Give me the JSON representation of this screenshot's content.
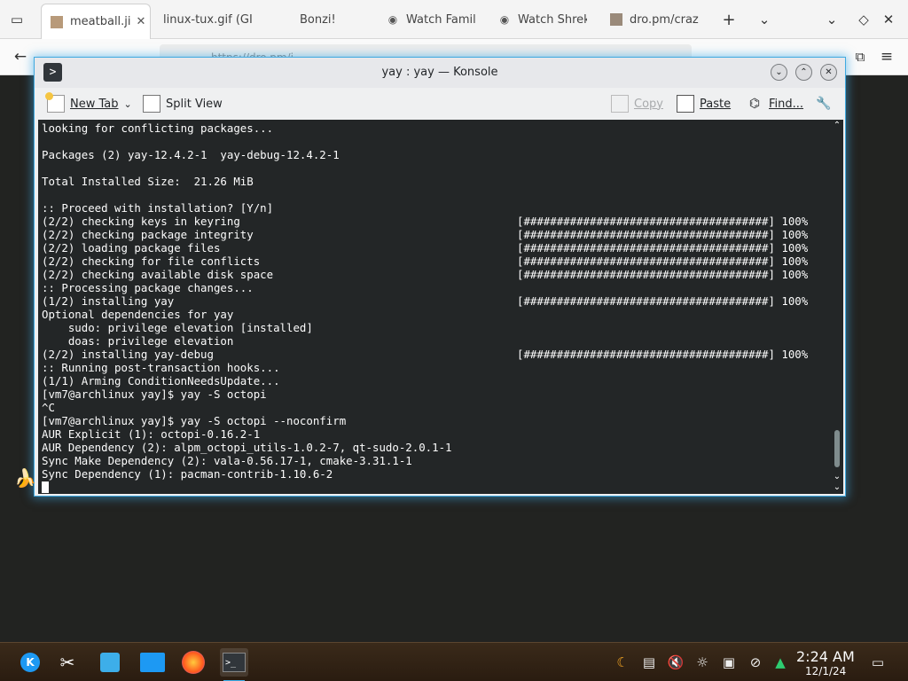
{
  "browser": {
    "tabs": [
      {
        "label": "meatball.ji",
        "icon": "image-icon",
        "active": true
      },
      {
        "label": "linux-tux.gif (GI",
        "icon": "none"
      },
      {
        "label": "Bonzi!",
        "icon": "none"
      },
      {
        "label": "Watch Famil",
        "icon": "wifi-icon"
      },
      {
        "label": "Watch Shrek",
        "icon": "wifi-icon"
      },
      {
        "label": "dro.pm/craz",
        "icon": "image-icon"
      }
    ],
    "url": "https://dro.pm/i"
  },
  "konsole": {
    "title": "yay : yay — Konsole",
    "toolbar": {
      "new_tab": "New Tab",
      "split_view": "Split View",
      "copy": "Copy",
      "paste": "Paste",
      "find": "Find..."
    },
    "terminal_lines": [
      {
        "text": "looking for conflicting packages...",
        "bar": ""
      },
      {
        "text": "",
        "bar": ""
      },
      {
        "text": "Packages (2) yay-12.4.2-1  yay-debug-12.4.2-1",
        "bar": ""
      },
      {
        "text": "",
        "bar": ""
      },
      {
        "text": "Total Installed Size:  21.26 MiB",
        "bar": ""
      },
      {
        "text": "",
        "bar": ""
      },
      {
        "text": ":: Proceed with installation? [Y/n]",
        "bar": ""
      },
      {
        "text": "(2/2) checking keys in keyring",
        "bar": "[#####################################] 100%"
      },
      {
        "text": "(2/2) checking package integrity",
        "bar": "[#####################################] 100%"
      },
      {
        "text": "(2/2) loading package files",
        "bar": "[#####################################] 100%"
      },
      {
        "text": "(2/2) checking for file conflicts",
        "bar": "[#####################################] 100%"
      },
      {
        "text": "(2/2) checking available disk space",
        "bar": "[#####################################] 100%"
      },
      {
        "text": ":: Processing package changes...",
        "bar": ""
      },
      {
        "text": "(1/2) installing yay",
        "bar": "[#####################################] 100%"
      },
      {
        "text": "Optional dependencies for yay",
        "bar": ""
      },
      {
        "text": "    sudo: privilege elevation [installed]",
        "bar": ""
      },
      {
        "text": "    doas: privilege elevation",
        "bar": ""
      },
      {
        "text": "(2/2) installing yay-debug",
        "bar": "[#####################################] 100%"
      },
      {
        "text": ":: Running post-transaction hooks...",
        "bar": ""
      },
      {
        "text": "(1/1) Arming ConditionNeedsUpdate...",
        "bar": ""
      },
      {
        "text": "[vm7@archlinux yay]$ yay -S octopi",
        "bar": ""
      },
      {
        "text": "^C",
        "bar": ""
      },
      {
        "text": "[vm7@archlinux yay]$ yay -S octopi --noconfirm",
        "bar": ""
      },
      {
        "text": "AUR Explicit (1): octopi-0.16.2-1",
        "bar": ""
      },
      {
        "text": "AUR Dependency (2): alpm_octopi_utils-1.0.2-7, qt-sudo-2.0.1-1",
        "bar": ""
      },
      {
        "text": "Sync Make Dependency (2): vala-0.56.17-1, cmake-3.31.1-1",
        "bar": ""
      },
      {
        "text": "Sync Dependency (1): pacman-contrib-1.10.6-2",
        "bar": ""
      }
    ]
  },
  "taskbar": {
    "time": "2:24 AM",
    "date": "12/1/24"
  }
}
